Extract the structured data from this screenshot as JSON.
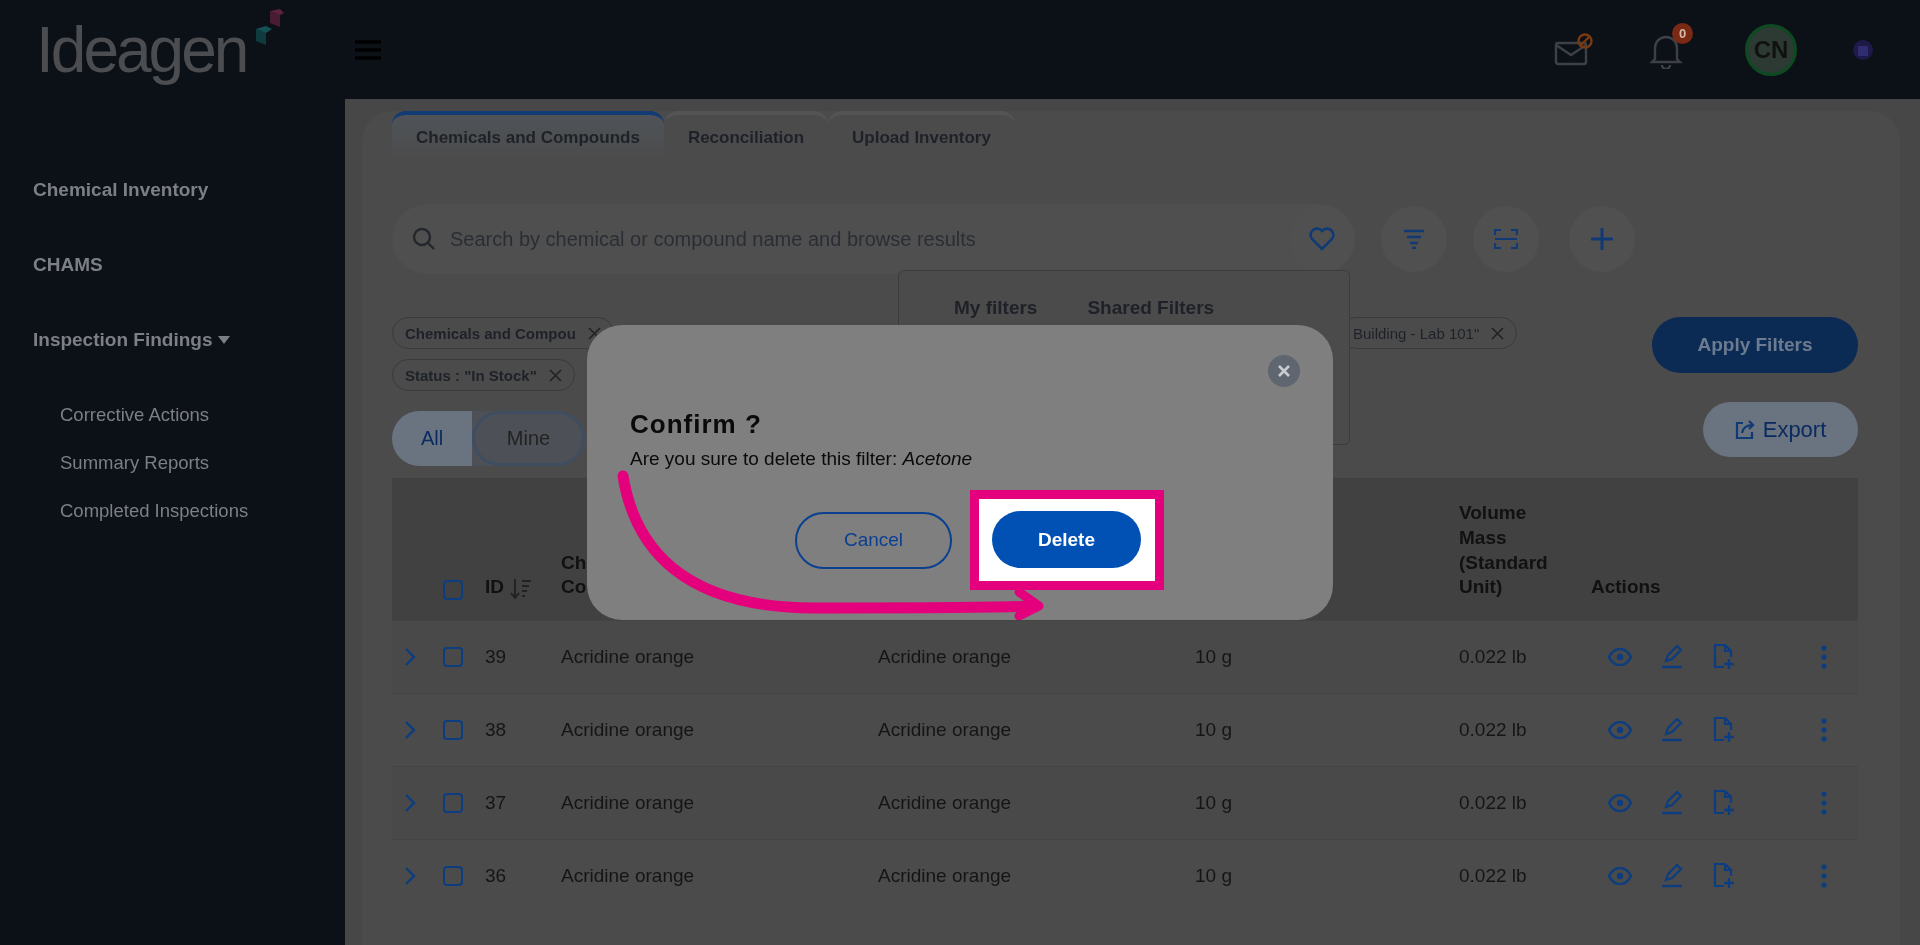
{
  "header": {
    "logo": "Ideagen",
    "notification_count": "0",
    "avatar_initials": "CN"
  },
  "sidebar": {
    "items": [
      {
        "label": "Chemical Inventory"
      },
      {
        "label": "CHAMS"
      },
      {
        "label": "Inspection Findings",
        "expanded": true,
        "children": [
          {
            "label": "Corrective Actions"
          },
          {
            "label": "Summary Reports"
          },
          {
            "label": "Completed Inspections"
          }
        ]
      }
    ]
  },
  "tabs": [
    {
      "label": "Chemicals and Compounds",
      "selected": true
    },
    {
      "label": "Reconciliation",
      "selected": false
    },
    {
      "label": "Upload Inventory",
      "selected": false
    }
  ],
  "search": {
    "placeholder": "Search by chemical or compound name and browse results"
  },
  "filter_menu": {
    "tabs": [
      {
        "label": "My filters"
      },
      {
        "label": "Shared Filters"
      }
    ]
  },
  "filter_chips": [
    {
      "label": "Chemicals and Compou",
      "bold": true
    },
    {
      "label": "Building - Lab 101\"",
      "bold": false
    },
    {
      "label": "Status : \"In Stock\"",
      "bold": true
    }
  ],
  "apply_button": "Apply Filters",
  "scope_toggle": [
    {
      "label": "All",
      "selected": true
    },
    {
      "label": "Mine",
      "selected": false
    }
  ],
  "export_button": "Export",
  "table": {
    "columns": [
      {
        "heading": "ID"
      },
      {
        "heading": "Ch\nCo"
      },
      {},
      {},
      {
        "heading": "Volume Mass (Standard Unit)"
      },
      {
        "heading": "Actions"
      }
    ],
    "all_checked": false,
    "rows": [
      {
        "cells": [
          "39",
          "Acridine orange",
          "Acridine orange",
          "10 g",
          "0.022 lb"
        ],
        "checked": false
      },
      {
        "cells": [
          "38",
          "Acridine orange",
          "Acridine orange",
          "10 g",
          "0.022 lb"
        ],
        "checked": false
      },
      {
        "cells": [
          "37",
          "Acridine orange",
          "Acridine orange",
          "10 g",
          "0.022 lb"
        ],
        "checked": false
      },
      {
        "cells": [
          "36",
          "Acridine orange",
          "Acridine orange",
          "10 g",
          "0.022 lb"
        ],
        "checked": false
      }
    ]
  },
  "dialog": {
    "title": "Confirm ?",
    "message": "Are you sure to delete this filter: *Acetone*",
    "buttons": [
      {
        "label": "Cancel",
        "kind": "secondary"
      },
      {
        "label": "Delete",
        "kind": "primary"
      }
    ]
  }
}
